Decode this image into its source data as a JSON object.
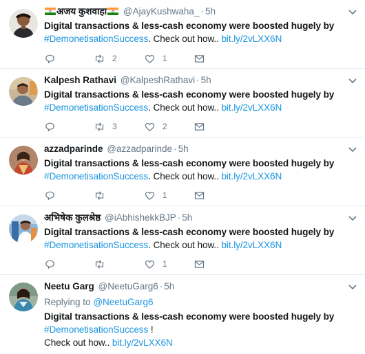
{
  "tweets": [
    {
      "name": "अजय कुशवाहा",
      "flags": true,
      "handle": "@AjayKushwaha_",
      "time": "5h",
      "line1": "Digital transactions & less-cash economy were boosted hugely by",
      "hashtag": "#DemonetisationSuccess",
      "after": ". Check out how..",
      "link": "bit.ly/2vLXX6N",
      "retweets": "2",
      "likes": "1"
    },
    {
      "name": "Kalpesh Rathavi",
      "flags": false,
      "handle": "@KalpeshRathavi",
      "time": "5h",
      "line1": "Digital transactions & less-cash economy were boosted hugely by",
      "hashtag": "#DemonetisationSuccess",
      "after": ". Check out how..",
      "link": "bit.ly/2vLXX6N",
      "retweets": "3",
      "likes": "2"
    },
    {
      "name": "azzadparinde",
      "flags": false,
      "handle": "@azzadparinde",
      "time": "5h",
      "line1": "Digital transactions & less-cash economy were boosted hugely by",
      "hashtag": "#DemonetisationSuccess",
      "after": ". Check out how..",
      "link": "bit.ly/2vLXX6N",
      "retweets": "",
      "likes": "1"
    },
    {
      "name": "अभिषेक कुलश्रेष्ठ",
      "flags": false,
      "handle": "@iAbhishekkBJP",
      "time": "5h",
      "line1": "Digital transactions & less-cash economy were boosted hugely by",
      "hashtag": "#DemonetisationSuccess",
      "after": ". Check out how..",
      "link": "bit.ly/2vLXX6N",
      "retweets": "",
      "likes": "1"
    },
    {
      "name": "Neetu Garg",
      "flags": false,
      "handle": "@NeetuGarg6",
      "time": "5h",
      "replying_label": "Replying to",
      "replying_to": "@NeetuGarg6",
      "line1": "Digital transactions & less-cash economy were boosted hugely by",
      "hashtag": "#DemonetisationSuccess",
      "after": " !",
      "line3": "Check out how..",
      "link": "bit.ly/2vLXX6N"
    }
  ],
  "icons": {
    "reply": "reply-icon",
    "retweet": "retweet-icon",
    "like": "heart-icon",
    "dm": "envelope-icon",
    "more": "chevron-down-icon"
  },
  "colors": {
    "link": "#1b95e0",
    "muted": "#657786",
    "text": "#14171a",
    "divider": "#e6ecf0"
  }
}
